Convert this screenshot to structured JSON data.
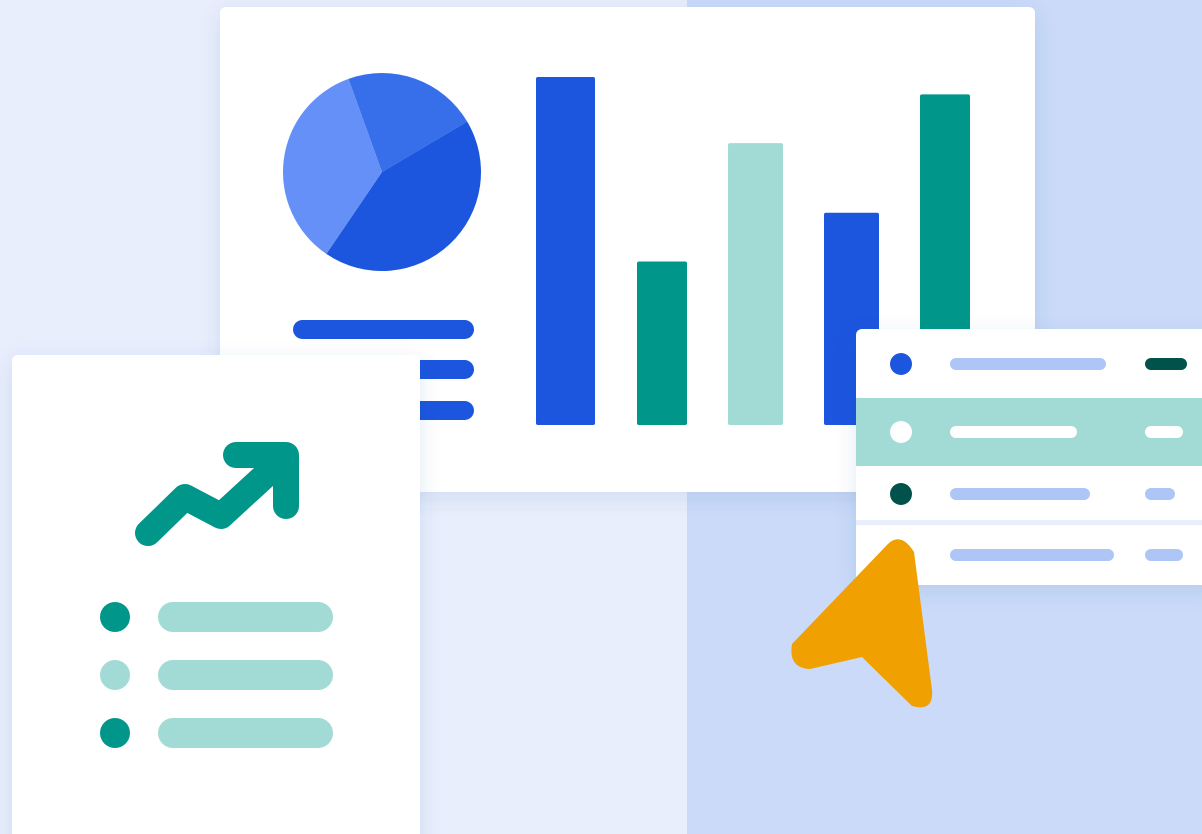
{
  "colors": {
    "bg_left": "#E8EEFC",
    "bg_right": "#CADAF8",
    "card": "#FFFFFF",
    "blue": "#1C55DE",
    "blue_mid": "#376EEA",
    "blue_light": "#6490F8",
    "teal": "#00978A",
    "teal_light": "#A2DBD5",
    "teal_dark": "#00524A",
    "lavender": "#AEC6F6",
    "orange": "#F0A000"
  },
  "icons": [
    "pie-chart-icon",
    "trend-up-arrow-icon",
    "cursor-arrow-icon"
  ],
  "chart_data": [
    {
      "type": "pie",
      "values": [
        22,
        43,
        35
      ],
      "slice_colors": [
        "blue_mid",
        "blue",
        "blue_light"
      ]
    },
    {
      "type": "bar",
      "values": [
        100,
        47,
        81,
        61,
        95
      ],
      "bar_colors": [
        "blue",
        "teal",
        "teal_light",
        "blue",
        "teal"
      ],
      "ylim": [
        0,
        100
      ]
    }
  ],
  "list_panel": {
    "rows": [
      {
        "dot_color": "blue",
        "bg": "card",
        "bar_color": "lavender",
        "pill_color": "teal_dark"
      },
      {
        "dot_color": "card",
        "bg": "teal_light",
        "bar_color": "card",
        "pill_color": "card"
      },
      {
        "dot_color": "teal_dark",
        "bg": "card",
        "bar_color": "lavender",
        "pill_color": "lavender"
      },
      {
        "dot_color": "blue",
        "bg": "card",
        "bar_color": "lavender",
        "pill_color": "lavender"
      }
    ]
  },
  "report_card": {
    "items": [
      {
        "dot_color": "teal",
        "bar_color": "teal_light"
      },
      {
        "dot_color": "teal_light",
        "bar_color": "teal_light"
      },
      {
        "dot_color": "teal",
        "bar_color": "teal_light"
      }
    ]
  }
}
